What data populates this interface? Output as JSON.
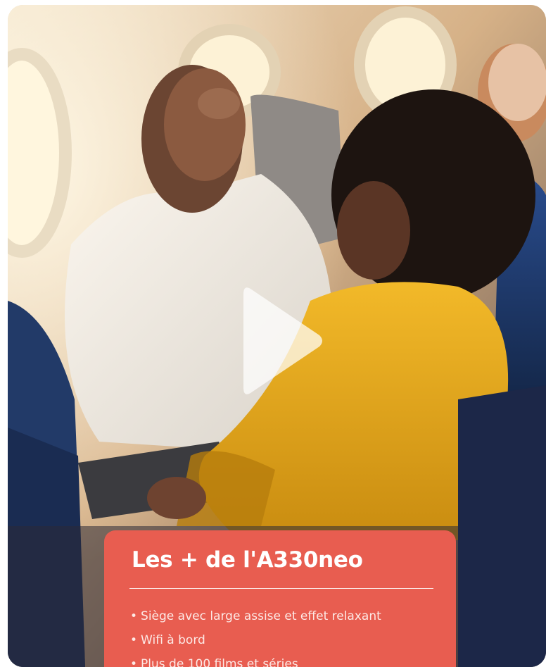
{
  "media": {
    "image_label": "cabin-passengers-photo",
    "play_icon": "play-icon"
  },
  "info_panel": {
    "title": "Les + de l'A330neo",
    "items": [
      "Siège avec large assise et effet relaxant",
      "Wifi à bord",
      "Plus de 100 films et séries"
    ]
  },
  "colors": {
    "panel_background": "#e85d50",
    "panel_text": "#ffffff",
    "shirt_yellow": "#e8a91c",
    "seat_blue": "#1f3f7a"
  }
}
